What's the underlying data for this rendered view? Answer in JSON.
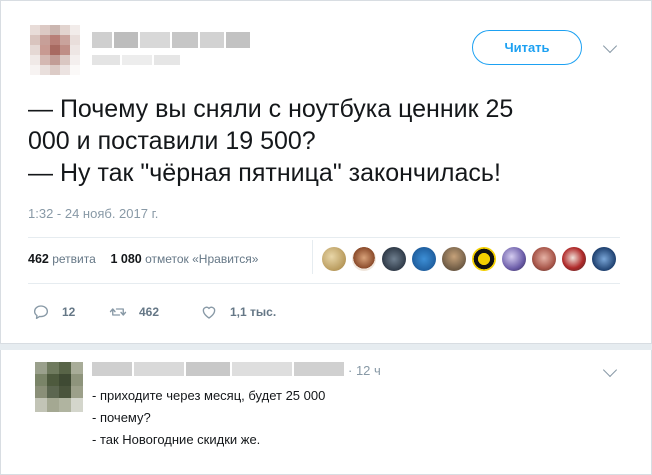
{
  "header": {
    "follow_label": "Читать"
  },
  "tweet": {
    "text_lines": [
      "— Почему вы сняли с ноутбука ценник 25",
      "000 и поставили 19 500?",
      "— Ну так \"чёрная пятница\" закончилась!"
    ],
    "timestamp": "1:32 - 24 нояб. 2017 г."
  },
  "stats": {
    "retweets_count": "462",
    "retweets_label": "ретвита",
    "likes_count": "1 080",
    "likes_label": "отметок «Нравится»"
  },
  "actions": {
    "reply_count": "12",
    "retweet_count": "462",
    "like_count": "1,1 тыс."
  },
  "reply": {
    "time": "· 12 ч",
    "lines": [
      "- приходите через месяц, будет 25 000",
      "- почему?",
      "- так Новогодние скидки же."
    ]
  },
  "colors": {
    "accent": "#1da1f2",
    "muted": "#8899a6",
    "text": "#14171a",
    "divider": "#e6ecf0"
  },
  "icons": [
    "reply-icon",
    "retweet-icon",
    "heart-icon",
    "chevron-down-icon"
  ]
}
